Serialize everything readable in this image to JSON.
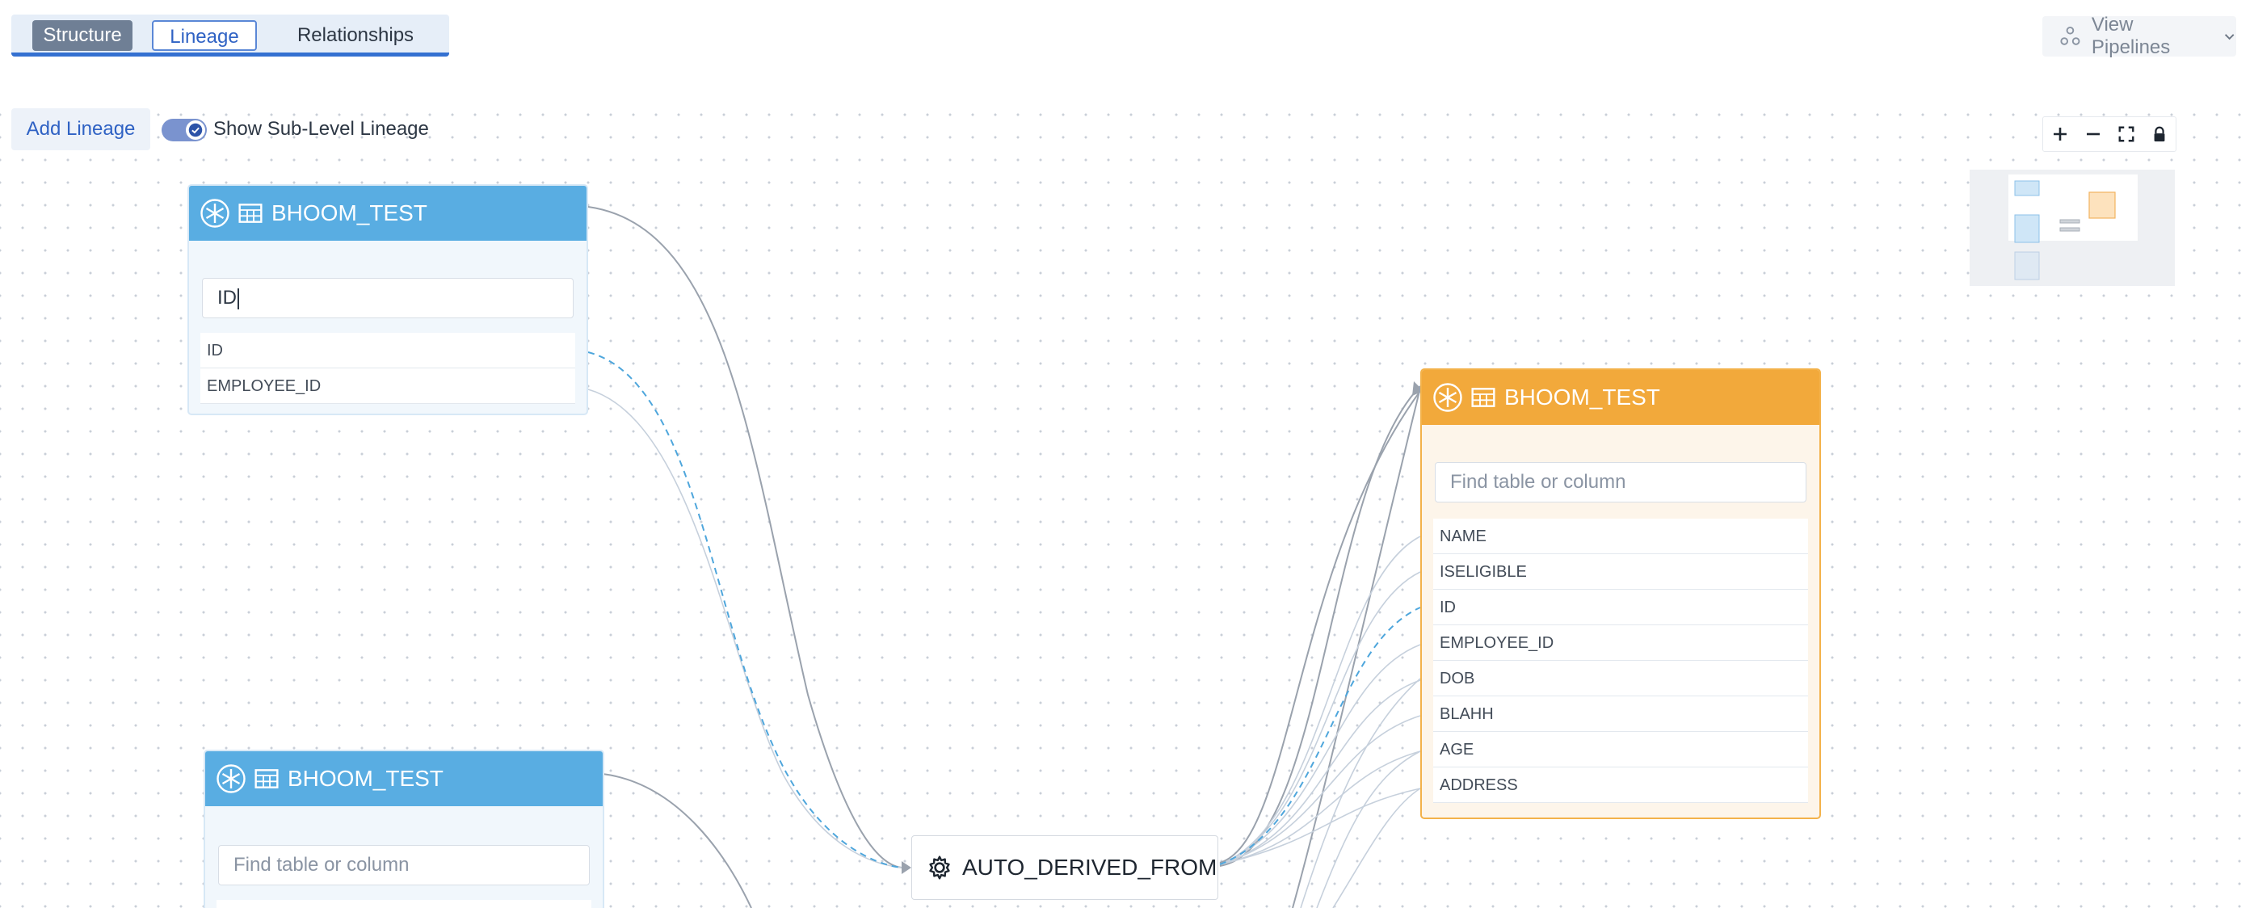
{
  "tabs": [
    {
      "label": "Structure",
      "state": "active"
    },
    {
      "label": "Lineage",
      "state": "selected"
    },
    {
      "label": "Relationships",
      "state": "normal"
    }
  ],
  "toolbar": {
    "view_pipelines_label": "View Pipelines",
    "add_lineage_label": "Add Lineage",
    "sublevel_toggle_label": "Show Sub-Level Lineage",
    "sublevel_toggle_on": true
  },
  "zoom_controls": [
    "zoom-in",
    "zoom-out",
    "fit-view",
    "lock"
  ],
  "nodes": {
    "source_top": {
      "title": "BHOOM_TEST",
      "search_value": "ID",
      "columns": [
        "ID",
        "EMPLOYEE_ID"
      ]
    },
    "source_bottom": {
      "title": "BHOOM_TEST",
      "search_placeholder": "Find table or column"
    },
    "process": {
      "title": "AUTO_DERIVED_FROM"
    },
    "target": {
      "title": "BHOOM_TEST",
      "search_placeholder": "Find table or column",
      "columns": [
        "NAME",
        "ISELIGIBLE",
        "ID",
        "EMPLOYEE_ID",
        "DOB",
        "BLAHH",
        "AGE",
        "ADDRESS"
      ]
    }
  },
  "colors": {
    "accent": "#3470d1",
    "source_header": "#59ade2",
    "target_header": "#f2a93b",
    "edge": "#9aa2ad",
    "edge_highlight": "#4ea6dc"
  }
}
